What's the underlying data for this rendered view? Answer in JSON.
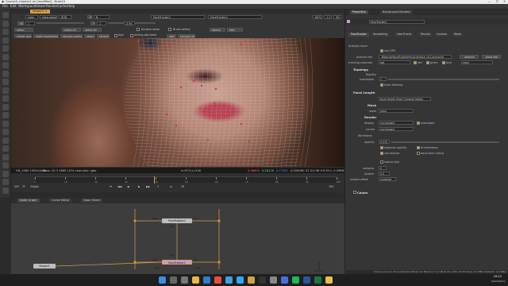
{
  "window": {
    "title": "Course3_chapter1.nk [modified] - Nuke15",
    "controls": {
      "min": "—",
      "max": "☐",
      "close": "✕"
    }
  },
  "menu": [
    "File",
    "Edit",
    "Workspace",
    "Viewer",
    "Render",
    "Cache",
    "Help"
  ],
  "toolbar_icons": [
    "pointer-icon",
    "paint-icon",
    "image-icon",
    "draw-icon",
    "time-icon",
    "channel-icon",
    "color-icon",
    "filter-icon",
    "keyer-icon",
    "merge-icon",
    "transform-icon",
    "3d-icon",
    "views-icon",
    "metadata-icon",
    "toolsets-icon",
    "other-icon",
    "furnace-icon",
    "caravr-icon",
    "cara-icon",
    "ocula-icon",
    "mochapro-icon",
    "nuke-icon"
  ],
  "viewer_tabs": {
    "active": "Viewer1",
    "close": "×"
  },
  "viewer_controls": {
    "row1": {
      "channels": "rgba",
      "alpha": "rgba.alpha",
      "colorspace": "RGB",
      "a_input": "A",
      "a_node": "FaceTracker1",
      "b_input": "B",
      "b_node": "FaceTracker1",
      "zoom": "80%",
      "proxy": "1:1",
      "mode": "3D"
    },
    "row2": {
      "gain_label": "f/2",
      "gain": "1",
      "gamma_label": "Y",
      "gamma": "1",
      "frame": "0.94"
    },
    "row3": {
      "btn1": "center pos",
      "btn2": "reset expression",
      "btn3": "remove points",
      "btn4": "setup",
      "btn5": "retrack",
      "check1": "lock",
      "check2": "mixing pos track",
      "btn6": "add",
      "btn7": "remove all"
    },
    "row4": {
      "label1": "setup",
      "label2": "setup all",
      "label3": "Surface mesh",
      "label4": "Brush radius",
      "label5": "ignore",
      "label6": "tear"
    }
  },
  "viewer_info": {
    "format": "HD_1080 1920x1080",
    "bbox": "bbox: 30 3 1860 1074 channels: rgba",
    "coords": "x=973 y=530",
    "r": "0.38609",
    "g": "0.26176",
    "b": "0.17541",
    "a": "0.00000",
    "hsvl": "H: 31 S:0.56 V:0.39 L: 0.29887"
  },
  "timeline": {
    "fps": "24*",
    "tf": "TF",
    "global": "Global",
    "ticks": [
      "1",
      "10",
      "20",
      "30",
      "40",
      "50",
      "60",
      "70",
      "80",
      "90",
      "100"
    ],
    "current": "1",
    "end": "100",
    "step": "10"
  },
  "node_tabs": [
    "Node Graph",
    "Curve Editor",
    "Dope Sheet"
  ],
  "nodes": {
    "tracker1": "FaceRubber1",
    "tracker2": "FaceTracker1",
    "viewer": "Viewer1",
    "labels": [
      "cam",
      "src",
      "cam",
      "src",
      "axis",
      "src",
      "cam",
      "axis"
    ]
  },
  "properties": {
    "tabs": [
      "Properties",
      "Background Renders"
    ],
    "node_name": "FaceTracker1",
    "subtabs": [
      "FaceTracker",
      "Smoothing",
      "UserTracks",
      "Results",
      "License",
      "Node"
    ],
    "analysis_input": "Analysis Input",
    "use_gpu": "use GPU",
    "analysis_file_label": "analysis file",
    "analysis_file": "_Material/FaceTrackerPrecache/face_v01.precache",
    "analyze_btn": "analyze",
    "show_info_btn": "show info",
    "tracking_channels_label": "tracking channels",
    "tracking_channels": "rgb",
    "channel_red": "red",
    "channel_green": "green",
    "channel_blue": "blue",
    "channel_none": "none",
    "topology": "Topology",
    "rigidity_label": "Rigidity",
    "expression_label": "expression",
    "expression_value": "1",
    "track_blinking": "track blinking",
    "focal_length": "Focal Length",
    "focal_value": "focal length (from Camera) below",
    "mask": "Mask",
    "mask_label": "mask",
    "mask_value": "none",
    "render": "Render",
    "display_label": "display",
    "display_value": "unchanged",
    "selectable": "selectable",
    "render_label": "render",
    "render_value": "unchanged",
    "wireframe_label": "Wireframe",
    "opacity_label": "opacity",
    "opacity_value": "0.315",
    "adaptive_opacity": "adaptive opacity",
    "lit_wireframe": "lit wireframe",
    "use_texture": "use texture",
    "backface_culling": "back-face culling",
    "motion_blur": "motion blur",
    "samples_label": "samples",
    "samples_value": "0",
    "shutter_label": "shutter",
    "shutter_value": "0.5",
    "shutter_offset_label": "shutter offset",
    "shutter_offset_value": "centered",
    "colors": "Colors",
    "status": "Channel Count: 20  Localization Mode: On  Memory: 3.1 GB (9.7%)  CPU: 32.9%  Disk: 0.1 MB/s  Network: 0.0 MB/s"
  },
  "taskbar": {
    "time": "18:22",
    "date": "22/05/2024",
    "icons": [
      "windows-icon",
      "search-icon",
      "taskview-icon",
      "explorer-icon",
      "edge-icon",
      "chrome-icon",
      "mail-icon",
      "photoshop-icon",
      "nuke-icon",
      "terminal-icon",
      "settings-icon",
      "store-icon",
      "spotify-icon",
      "word-icon",
      "excel-icon",
      "folder-icon"
    ]
  }
}
